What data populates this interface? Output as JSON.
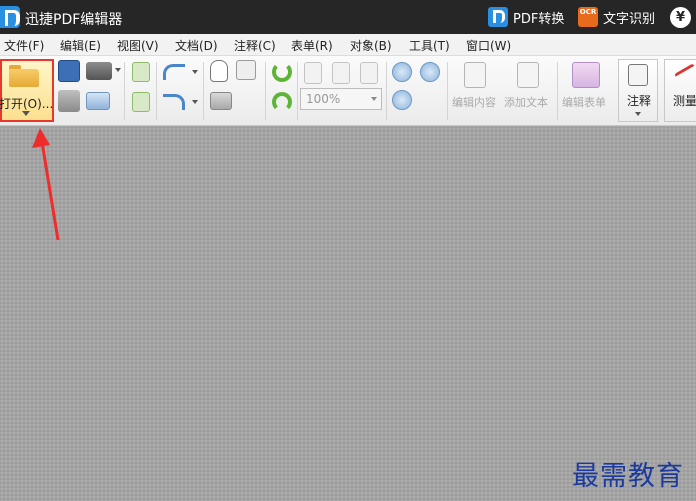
{
  "title_bar": {
    "app_title": "迅捷PDF编辑器",
    "pdf_convert_label": "PDF转换",
    "ocr_badge": "OCR",
    "ocr_label": "文字识别",
    "yen_symbol": "¥"
  },
  "menu": [
    "文件(F)",
    "编辑(E)",
    "视图(V)",
    "文档(D)",
    "注释(C)",
    "表单(R)",
    "对象(B)",
    "工具(T)",
    "窗口(W)"
  ],
  "toolbar": {
    "open_label": "打开(O)...",
    "zoom_value": "100%",
    "edit_content_label": "编辑内容",
    "add_text_label": "添加文本",
    "edit_form_label": "编辑表单",
    "annotate_label": "注释",
    "measure_label": "测量"
  },
  "colors": {
    "titlebar": "#262626",
    "highlight_border": "#e8372c",
    "open_bg": "#fbe08e",
    "doc_bg": "#a6a6a6",
    "watermark": "#1b3a9c"
  },
  "icons": [
    "folder-icon",
    "save-icon",
    "scanner-icon",
    "print-icon",
    "email-icon",
    "copy-icon",
    "undo-icon",
    "redo-icon",
    "hand-icon",
    "select-text-icon",
    "snapshot-icon",
    "rotate-icon",
    "actual-size-icon",
    "fit-page-icon",
    "fit-width-icon",
    "zoom-in-icon",
    "zoom-out-icon",
    "add-icon"
  ],
  "watermark": "最需教育"
}
